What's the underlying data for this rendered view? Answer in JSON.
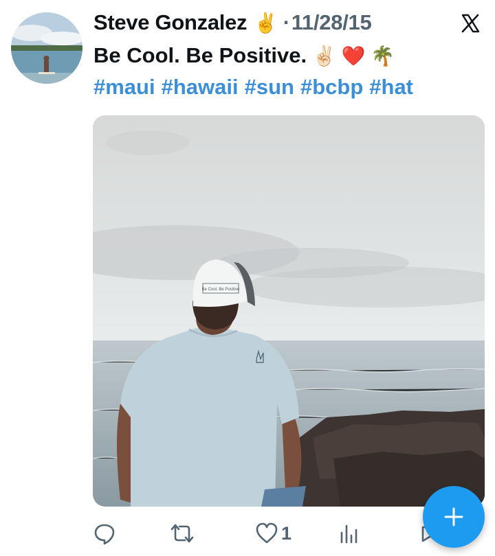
{
  "tweet": {
    "display_name": "Steve Gonzalez",
    "name_emoji": "✌️",
    "separator": "·",
    "timestamp": "11/28/15",
    "text": "Be Cool. Be Positive.",
    "text_emojis": "✌🏻 ❤️ 🌴",
    "hashtags": [
      "#maui",
      "#hawaii",
      "#sun",
      "#bcbp",
      "#hat"
    ]
  },
  "media": {
    "hat_patch_text": "Be Cool. Be Positive"
  },
  "actions": {
    "reply_icon": "reply-icon",
    "retweet_icon": "retweet-icon",
    "like_icon": "heart-icon",
    "like_count": "1",
    "views_icon": "views-icon",
    "share_icon": "share-icon"
  },
  "compose": {
    "icon": "plus-icon",
    "label": "+"
  },
  "colors": {
    "hashtag": "#3c8fd6",
    "fab": "#1d9bf0",
    "muted": "#536471",
    "text": "#0f1419"
  }
}
